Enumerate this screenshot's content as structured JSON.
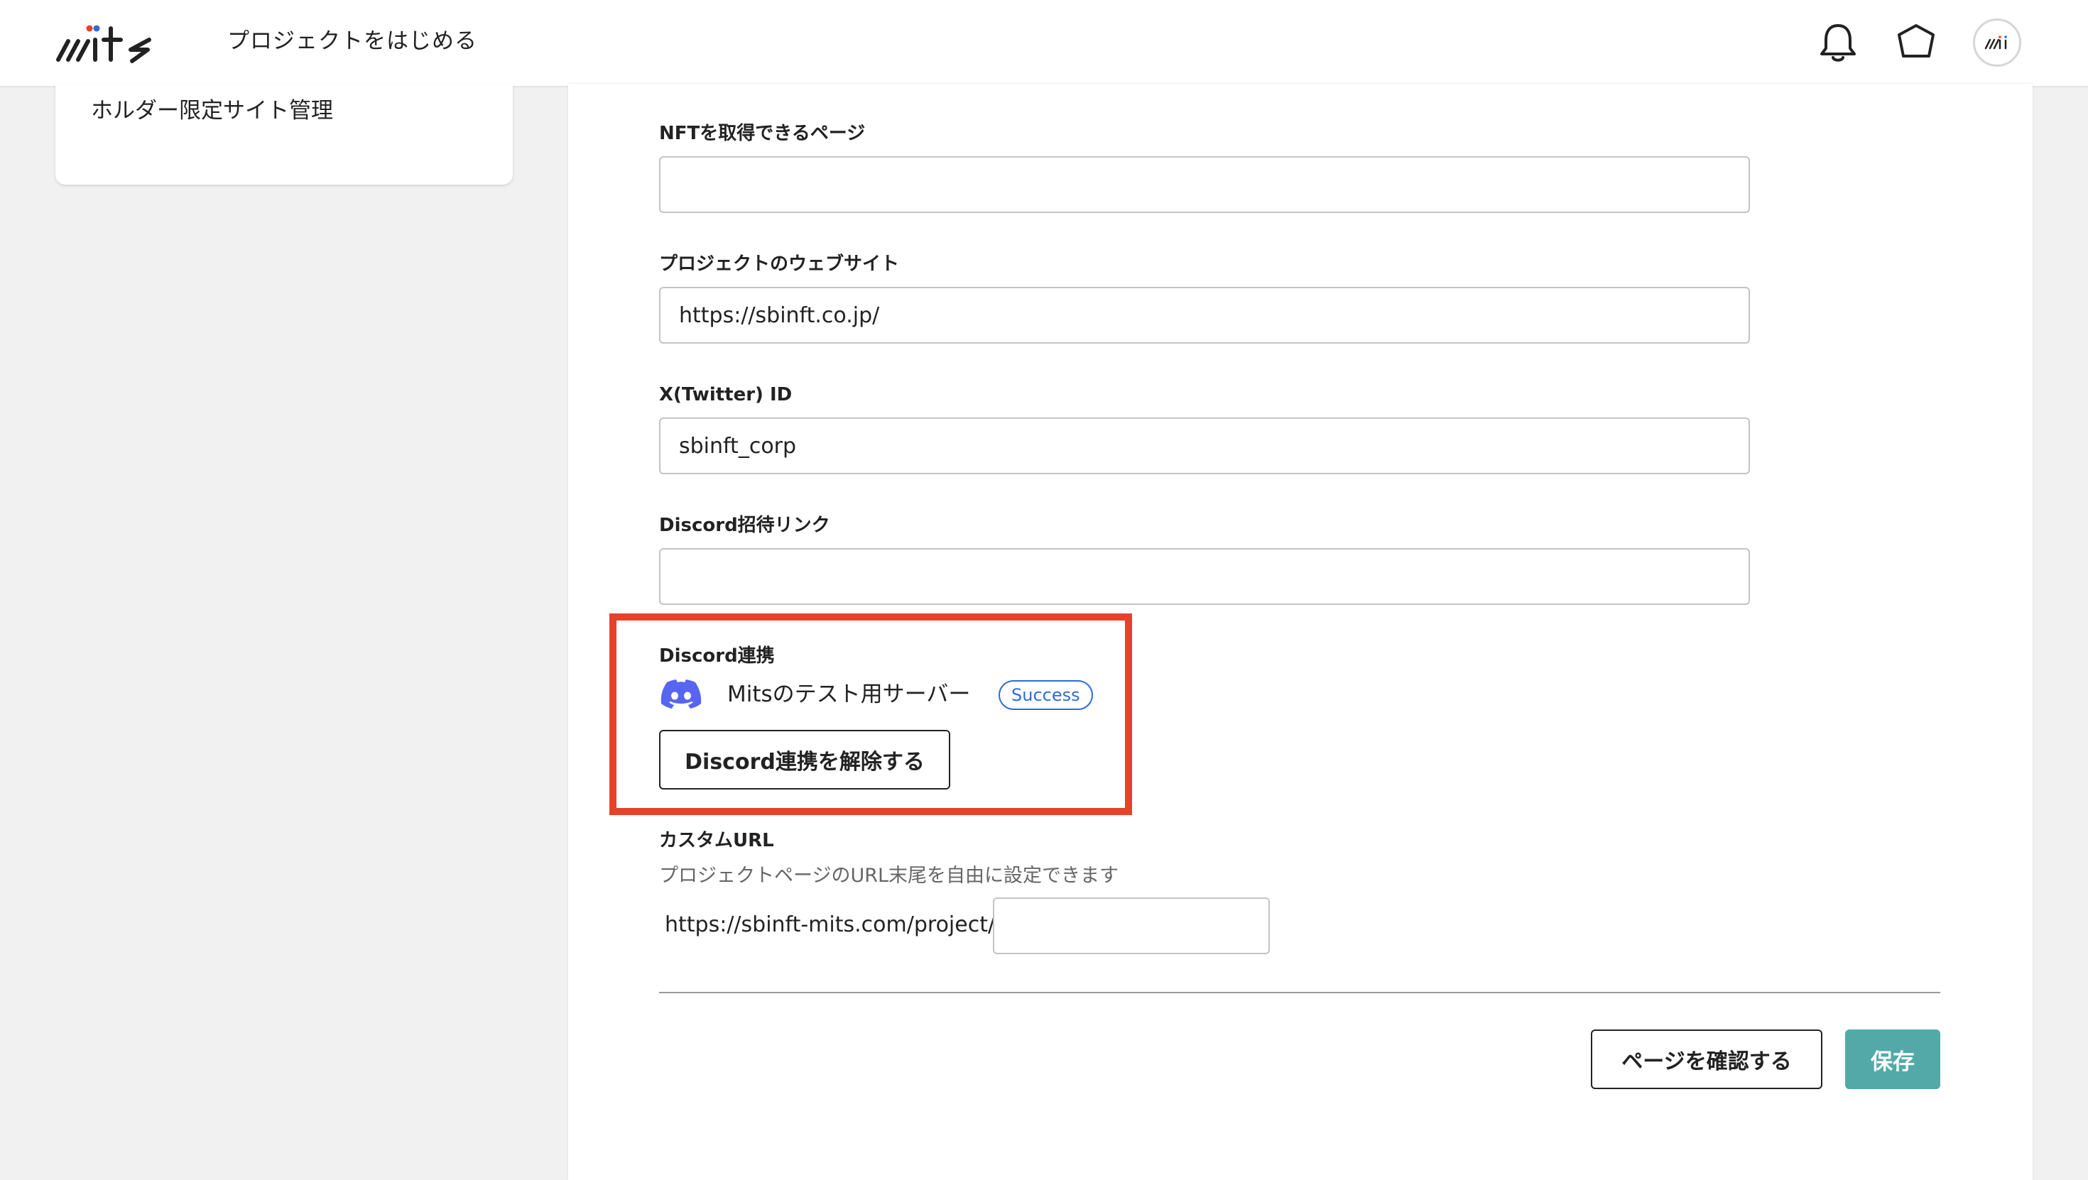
{
  "app": {
    "logo_text": "mits"
  },
  "header": {
    "title": "プロジェクトをはじめる",
    "icons": [
      "bell-icon",
      "hexagon-icon",
      "avatar-icon"
    ]
  },
  "sidebar": {
    "items": [
      {
        "label": "ホルダー限定サイト管理"
      }
    ]
  },
  "form": {
    "nft_page": {
      "label": "NFTを取得できるページ",
      "value": ""
    },
    "website": {
      "label": "プロジェクトのウェブサイト",
      "value": "https://sbinft.co.jp/"
    },
    "twitter": {
      "label": "X(Twitter) ID",
      "value": "sbinft_corp"
    },
    "discord_invite": {
      "label": "Discord招待リンク",
      "value": ""
    },
    "discord_link": {
      "label": "Discord連携",
      "server_name": "Mitsのテスト用サーバー",
      "status": "Success",
      "unlink_label": "Discord連携を解除する"
    },
    "custom_url": {
      "label": "カスタムURL",
      "hint": "プロジェクトページのURL末尾を自由に設定できます",
      "prefix": "https://sbinft-mits.com/project/",
      "value": ""
    }
  },
  "actions": {
    "confirm_label": "ページを確認する",
    "save_label": "保存"
  },
  "colors": {
    "save_button": "#52a9a8",
    "highlight_border": "#e8412a",
    "success_badge": "#2f6ad9",
    "discord_icon": "#5865f2",
    "page_background": "#f1f1f1"
  }
}
